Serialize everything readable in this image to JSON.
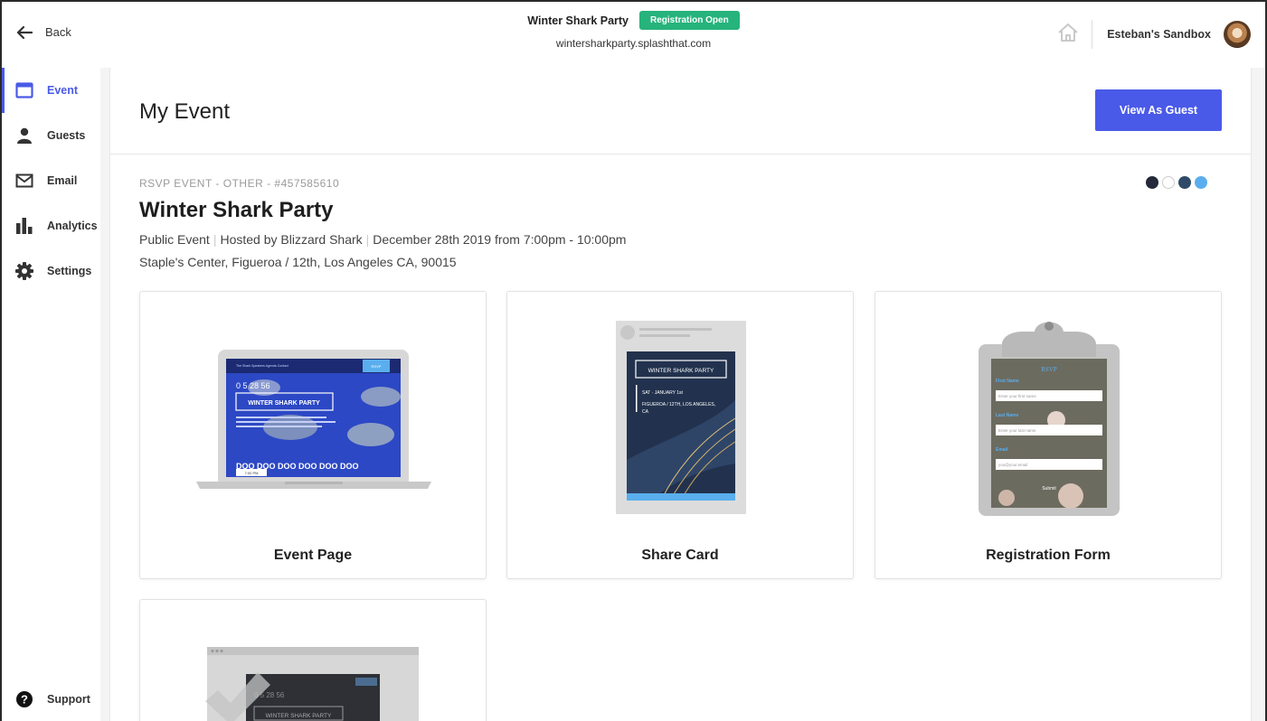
{
  "header": {
    "back_label": "Back",
    "event_name": "Winter Shark Party",
    "status_badge": "Registration Open",
    "event_url": "wintersharkparty.splashthat.com",
    "account_name": "Esteban's Sandbox"
  },
  "sidebar": {
    "items": [
      {
        "label": "Event",
        "icon": "calendar-window-icon",
        "active": true
      },
      {
        "label": "Guests",
        "icon": "person-icon"
      },
      {
        "label": "Email",
        "icon": "envelope-icon"
      },
      {
        "label": "Analytics",
        "icon": "bar-chart-icon"
      },
      {
        "label": "Settings",
        "icon": "gear-icon"
      }
    ],
    "support_label": "Support"
  },
  "main": {
    "page_title": "My Event",
    "view_as_guest_label": "View As Guest",
    "event_meta": "RSVP EVENT - OTHER - #457585610",
    "theme_colors": [
      "#25293a",
      "#ffffff",
      "#2f4a68",
      "#5aaeed"
    ],
    "event_title": "Winter Shark Party",
    "details": {
      "visibility": "Public Event",
      "host": "Hosted by Blizzard Shark",
      "datetime": "December 28th 2019 from 7:00pm - 10:00pm"
    },
    "address": "Staple's Center, Figueroa / 12th, Los Angeles CA, 90015",
    "cards": [
      {
        "label": "Event Page"
      },
      {
        "label": "Share Card"
      },
      {
        "label": "Registration Form"
      },
      {
        "label": ""
      }
    ]
  },
  "previews": {
    "event_page": {
      "nav_text": "The Shark   Speakers   Agenda   Contact",
      "button_text": "RSVP",
      "countdown": "0  5  28  56",
      "title": "WINTER SHARK PARTY",
      "doo_text": "DOO DOO DOO DOO DOO DOO",
      "footer_text": "7:00 PM"
    },
    "share_card": {
      "title": "WINTER SHARK PARTY",
      "date_line": "SAT · JANUARY 1st",
      "address_line_1": "FIGUEROA / 12TH, LOS ANGELES,",
      "address_line_2": "CA"
    },
    "registration_form": {
      "heading": "RSVP",
      "first_name_label": "First Name",
      "first_name_placeholder": "Enter your first name",
      "last_name_label": "Last Name",
      "last_name_placeholder": "Enter your last name",
      "email_label": "Email",
      "email_placeholder": "you@your.email",
      "submit_label": "Submit"
    },
    "fourth": {
      "countdown": "0  5  28  56",
      "title": "WINTER SHARK PARTY"
    }
  }
}
